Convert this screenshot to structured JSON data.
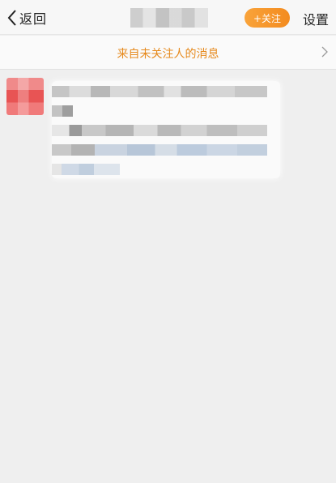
{
  "navbar": {
    "back_label": "返回",
    "follow_label": "+关注",
    "settings_label": "设置"
  },
  "banner": {
    "text": "来自未关注人的消息"
  },
  "colors": {
    "accent": "#f39b2a",
    "banner_text": "#e68a1e",
    "background": "#efefef"
  },
  "icons": {
    "back": "chevron-left-icon",
    "banner_arrow": "chevron-right-icon"
  }
}
